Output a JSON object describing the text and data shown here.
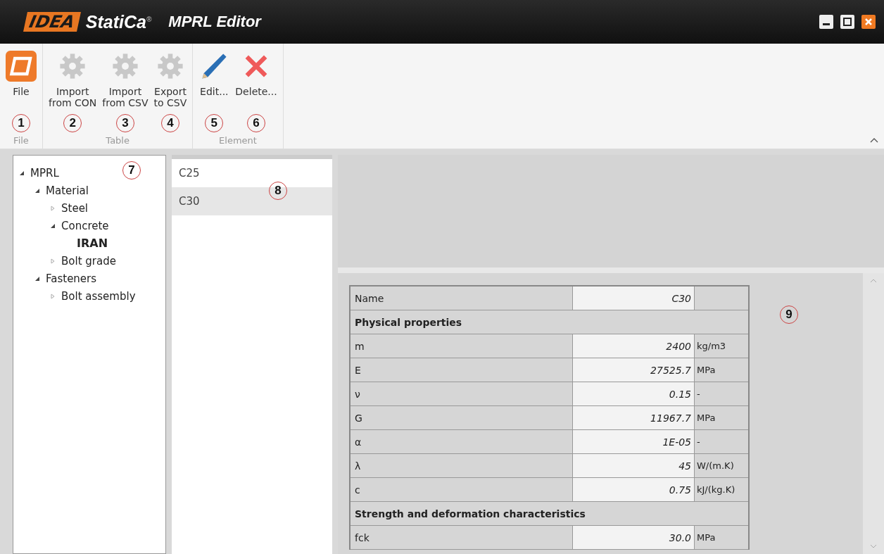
{
  "window": {
    "brand": "IDEA",
    "product": "StatiCa",
    "mark": "®",
    "title": "MPRL Editor"
  },
  "ribbon": {
    "groups": [
      {
        "label": "File",
        "buttons": [
          {
            "kind": "app",
            "label": "File",
            "callout": "1"
          }
        ]
      },
      {
        "label": "Table",
        "buttons": [
          {
            "kind": "gear",
            "label": "Import\nfrom CON",
            "callout": "2"
          },
          {
            "kind": "gear",
            "label": "Import\nfrom CSV",
            "callout": "3"
          },
          {
            "kind": "gear",
            "label": "Export\nto CSV",
            "callout": "4"
          }
        ]
      },
      {
        "label": "Element",
        "buttons": [
          {
            "kind": "pencil",
            "label": "Edit...",
            "callout": "5"
          },
          {
            "kind": "delete",
            "label": "Delete...",
            "callout": "6"
          }
        ]
      }
    ]
  },
  "tree": {
    "callout": "7",
    "items": [
      {
        "label": "MPRL",
        "expanded": true,
        "children": [
          {
            "label": "Material",
            "expanded": true,
            "children": [
              {
                "label": "Steel",
                "expanded": false
              },
              {
                "label": "Concrete",
                "expanded": true,
                "children": [
                  {
                    "label": "IRAN",
                    "selected": true
                  }
                ]
              },
              {
                "label": "Bolt grade",
                "expanded": false
              }
            ]
          },
          {
            "label": "Fasteners",
            "expanded": true,
            "children": [
              {
                "label": "Bolt assembly",
                "expanded": false
              }
            ]
          }
        ]
      }
    ]
  },
  "list": {
    "callout": "8",
    "items": [
      {
        "label": "C25",
        "selected": false
      },
      {
        "label": "C30",
        "selected": true
      }
    ]
  },
  "properties": {
    "callout": "9",
    "rows": [
      {
        "kind": "property",
        "name": "Name",
        "value": "C30"
      },
      {
        "kind": "section",
        "name": "Physical properties"
      },
      {
        "kind": "property",
        "name": "m",
        "value": "2400",
        "unit": "kg/m3"
      },
      {
        "kind": "property",
        "name": "E",
        "value": "27525.7",
        "unit": "MPa"
      },
      {
        "kind": "property",
        "name": "ν",
        "value": "0.15",
        "unit": "-"
      },
      {
        "kind": "property",
        "name": "G",
        "value": "11967.7",
        "unit": "MPa"
      },
      {
        "kind": "property",
        "name": "α",
        "value": "1E-05",
        "unit": "-"
      },
      {
        "kind": "property",
        "name": "λ",
        "value": "45",
        "unit": "W/(m.K)"
      },
      {
        "kind": "property",
        "name": "c",
        "value": "0.75",
        "unit": "kJ/(kg.K)"
      },
      {
        "kind": "section",
        "name": "Strength and deformation characteristics"
      },
      {
        "kind": "property",
        "name": "fck",
        "value": "30.0",
        "unit": "MPa"
      }
    ]
  }
}
